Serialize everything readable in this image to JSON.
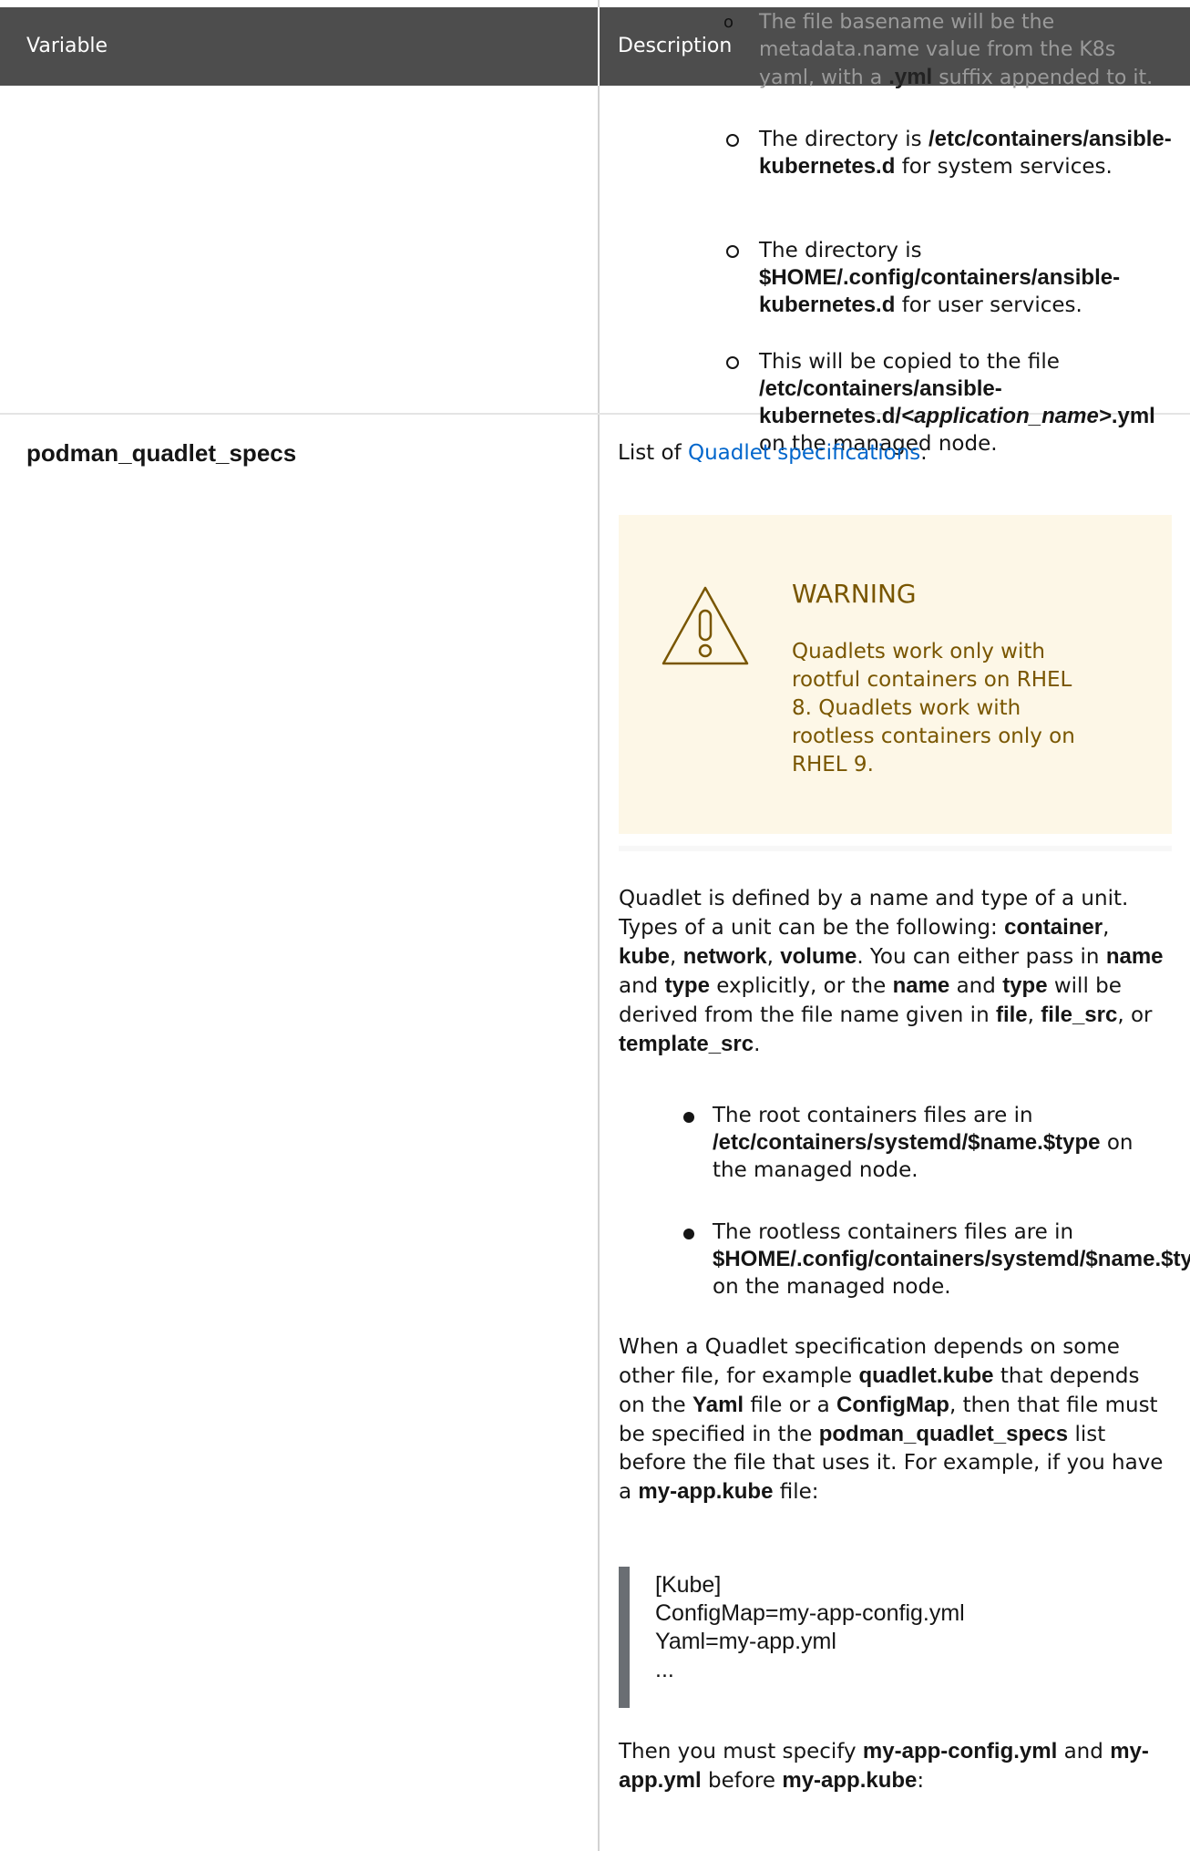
{
  "header": {
    "variable_col": "Variable",
    "description_col": "Description"
  },
  "overlap_top": {
    "part1": "The file basename will be the metadata.name value from the K8s yaml, with a ",
    "code": ".yml",
    "part2": " suffix appended to it."
  },
  "row1_items": [
    {
      "pre": "The directory is ",
      "code": "/etc/containers/ansible-kubernetes.d",
      "post": " for system services."
    },
    {
      "pre": "The directory is ",
      "code": "$HOME/.config/containers/ansible-kubernetes.d",
      "post": " for user services."
    },
    {
      "pre": "This will be copied to the file ",
      "code": "/etc/containers/ansible-kubernetes.d/",
      "code_italic": "<application_name>",
      "code2": ".yml",
      "post": " on the managed node."
    }
  ],
  "row2": {
    "variable": "podman_quadlet_specs",
    "intro_pre": "List of ",
    "intro_link": "Quadlet specifications",
    "intro_post": ".",
    "warning": {
      "icon": "warning-triangle-icon",
      "title": "WARNING",
      "text": "Quadlets work only with rootful containers on RHEL 8. Quadlets work with rootless containers only on RHEL 9."
    },
    "para1": {
      "t1": "Quadlet is defined by a name and type of a unit. Types of a unit can be the following: ",
      "c1": "container",
      "t2": ", ",
      "c2": "kube",
      "t3": ", ",
      "c3": "network",
      "t4": ", ",
      "c4": "volume",
      "t5": ". You can either pass in ",
      "c5": "name",
      "t6": " and ",
      "c6": "type",
      "t7": " explicitly, or the ",
      "c7": "name",
      "t8": " and ",
      "c8": "type",
      "t9": " will be derived from the file name given in ",
      "c9": "file",
      "t10": ", ",
      "c10": "file_src",
      "t11": ", or ",
      "c11": "template_src",
      "t12": "."
    },
    "bullets": [
      {
        "pre": "The root containers files are in ",
        "code": "/etc/containers/systemd/$name.$type",
        "post": " on the managed node."
      },
      {
        "pre": "The rootless containers files are in ",
        "code": "$HOME/.config/containers/systemd/$name.$type",
        "post": " on the managed node."
      }
    ],
    "para2": {
      "t1": "When a Quadlet specification depends on some other file, for example ",
      "c1": "quadlet.kube",
      "t2": " that depends on the ",
      "c2": "Yaml",
      "t3": " file or a ",
      "c3": "ConfigMap",
      "t4": ", then that file must be specified in the ",
      "c4": "podman_quadlet_specs",
      "t5": " list before the file that uses it. For example, if you have a ",
      "c5": "my-app.kube",
      "t6": " file:"
    },
    "code_lines": [
      "[Kube]",
      "ConfigMap=my-app-config.yml",
      "Yaml=my-app.yml",
      "..."
    ],
    "para3": {
      "t1": "Then you must specify ",
      "c1": "my-app-config.yml",
      "t2": " and ",
      "c2": "my-app.yml",
      "t3": " before ",
      "c3": "my-app.kube",
      "t4": ":"
    }
  }
}
